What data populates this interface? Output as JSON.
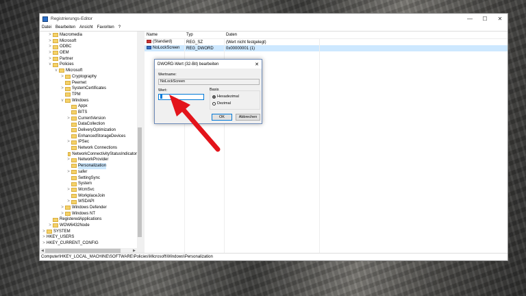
{
  "window": {
    "title": "Registrierungs-Editor",
    "min_glyph": "—",
    "max_glyph": "☐",
    "close_glyph": "✕"
  },
  "menu": [
    "Datei",
    "Bearbeiten",
    "Ansicht",
    "Favoriten",
    "?"
  ],
  "tree": [
    {
      "label": "Macromedia",
      "depth": 1,
      "exp": ">"
    },
    {
      "label": "Microsoft",
      "depth": 1,
      "exp": ">"
    },
    {
      "label": "ODBC",
      "depth": 1,
      "exp": ">"
    },
    {
      "label": "OEM",
      "depth": 1,
      "exp": ">"
    },
    {
      "label": "Partner",
      "depth": 1,
      "exp": ">"
    },
    {
      "label": "Policies",
      "depth": 1,
      "exp": "v"
    },
    {
      "label": "Microsoft",
      "depth": 2,
      "exp": "v"
    },
    {
      "label": "Cryptography",
      "depth": 3,
      "exp": ">"
    },
    {
      "label": "Peernet",
      "depth": 3,
      "exp": ""
    },
    {
      "label": "SystemCertificates",
      "depth": 3,
      "exp": ">"
    },
    {
      "label": "TPM",
      "depth": 3,
      "exp": ""
    },
    {
      "label": "Windows",
      "depth": 3,
      "exp": "v"
    },
    {
      "label": "Appx",
      "depth": 4,
      "exp": ""
    },
    {
      "label": "BITS",
      "depth": 4,
      "exp": ""
    },
    {
      "label": "CurrentVersion",
      "depth": 4,
      "exp": ">"
    },
    {
      "label": "DataCollection",
      "depth": 4,
      "exp": ""
    },
    {
      "label": "DeliveryOptimization",
      "depth": 4,
      "exp": ""
    },
    {
      "label": "EnhancedStorageDevices",
      "depth": 4,
      "exp": ""
    },
    {
      "label": "IPSec",
      "depth": 4,
      "exp": ">"
    },
    {
      "label": "Network Connections",
      "depth": 4,
      "exp": ""
    },
    {
      "label": "NetworkConnectivityStatusIndicator",
      "depth": 4,
      "exp": ""
    },
    {
      "label": "NetworkProvider",
      "depth": 4,
      "exp": ">"
    },
    {
      "label": "Personalization",
      "depth": 4,
      "exp": "",
      "selected": true
    },
    {
      "label": "safer",
      "depth": 4,
      "exp": ">"
    },
    {
      "label": "SettingSync",
      "depth": 4,
      "exp": ""
    },
    {
      "label": "System",
      "depth": 4,
      "exp": ""
    },
    {
      "label": "WcmSvc",
      "depth": 4,
      "exp": ">"
    },
    {
      "label": "WorkplaceJoin",
      "depth": 4,
      "exp": ""
    },
    {
      "label": "WSDAPI",
      "depth": 4,
      "exp": ">"
    },
    {
      "label": "Windows Defender",
      "depth": 3,
      "exp": ">"
    },
    {
      "label": "Windows NT",
      "depth": 3,
      "exp": ">"
    },
    {
      "label": "RegisteredApplications",
      "depth": 1,
      "exp": ""
    },
    {
      "label": "WOW6432Node",
      "depth": 1,
      "exp": ">"
    },
    {
      "label": "SYSTEM",
      "depth": 0,
      "exp": ">"
    },
    {
      "label": "HKEY_USERS",
      "depth": 0,
      "exp": ">",
      "nofolder": true
    },
    {
      "label": "HKEY_CURRENT_CONFIG",
      "depth": 0,
      "exp": ">",
      "nofolder": true
    }
  ],
  "list": {
    "headers": {
      "name": "Name",
      "type": "Typ",
      "data": "Daten"
    },
    "rows": [
      {
        "name": "(Standard)",
        "type": "REG_SZ",
        "data": "(Wert nicht festgelegt)",
        "icon": "string-value-icon"
      },
      {
        "name": "NoLockScreen",
        "type": "REG_DWORD",
        "data": "0x00000001 (1)",
        "icon": "dword-value-icon",
        "selected": true
      }
    ]
  },
  "status": "Computer\\HKEY_LOCAL_MACHINE\\SOFTWARE\\Policies\\Microsoft\\Windows\\Personalization",
  "dialog": {
    "title": "DWORD-Wert (32-Bit) bearbeiten",
    "close_glyph": "✕",
    "name_label": "Wertname:",
    "name_value": "NoLockScreen",
    "value_label": "Wert:",
    "value_value": "1",
    "base_label": "Basis",
    "hex_label": "Hexadezimal",
    "dec_label": "Dezimal",
    "hex_selected": true,
    "ok": "OK",
    "cancel": "Abbrechen"
  },
  "colors": {
    "annotation_arrow": "#e3141b",
    "selection": "#cde8ff",
    "accent": "#0078d7"
  }
}
